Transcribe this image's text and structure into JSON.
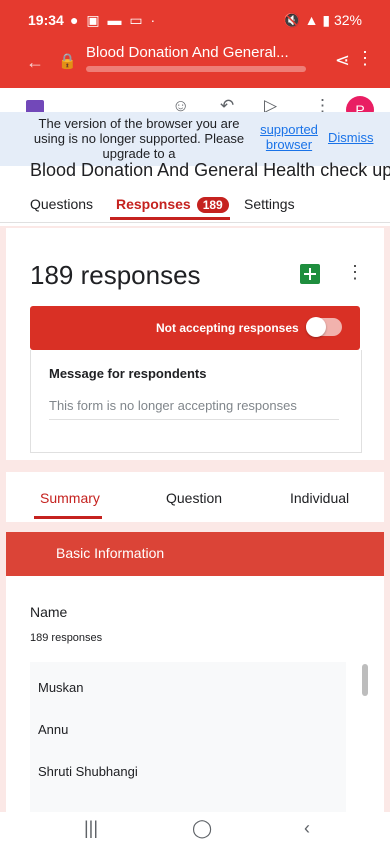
{
  "status": {
    "time": "19:34",
    "battery": "32%"
  },
  "browser": {
    "title": "Blood Donation And General..."
  },
  "banner": {
    "message": "The version of the browser you are using is no longer supported. Please upgrade to a",
    "link": "supported browser",
    "dismiss": "Dismiss"
  },
  "form": {
    "title": "Blood Donation And General Health check up",
    "tabs": {
      "questions": "Questions",
      "responses": "Responses",
      "responses_count": "189",
      "settings": "Settings"
    }
  },
  "responses": {
    "count_label": "189 responses",
    "accepting_label": "Not accepting responses",
    "accepting": false,
    "message_heading": "Message for respondents",
    "message_text": "This form is no longer accepting responses"
  },
  "subtabs": {
    "summary": "Summary",
    "question": "Question",
    "individual": "Individual"
  },
  "section": {
    "title": "Basic Information",
    "question": "Name",
    "question_responses": "189 responses",
    "answers": [
      "Muskan",
      "Annu",
      "Shruti Shubhangi"
    ]
  },
  "colors": {
    "brand_red": "#e53a2f",
    "accent": "#c5221f",
    "sheets_green": "#1e8e3e"
  },
  "icons": [
    "back-arrow-icon",
    "lock-icon",
    "share-icon",
    "more-vert-icon",
    "palette-icon",
    "undo-icon",
    "send-icon",
    "sheets-icon",
    "recents-icon",
    "home-icon",
    "nav-back-icon"
  ]
}
